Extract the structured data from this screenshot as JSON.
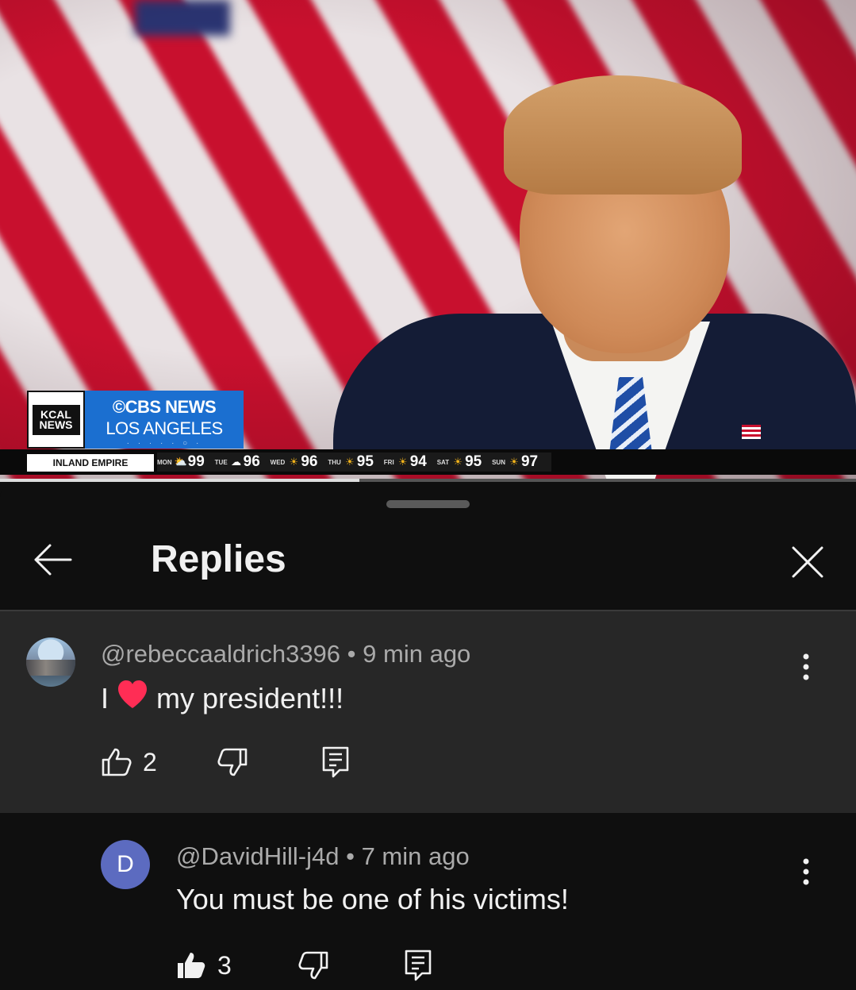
{
  "video": {
    "logo_kcal_line1": "KCAL",
    "logo_kcal_line2": "NEWS",
    "cbs_line1": "©CBS NEWS",
    "cbs_line2": "LOS ANGELES",
    "cbs_dots": "· · · · · ○ ·",
    "region": "INLAND EMPIRE",
    "forecast": [
      {
        "day": "MON",
        "icon": "cloud-sun-icon",
        "temp": "99"
      },
      {
        "day": "TUE",
        "icon": "cloud-icon",
        "temp": "96"
      },
      {
        "day": "WED",
        "icon": "sun-icon",
        "temp": "96"
      },
      {
        "day": "THU",
        "icon": "sun-icon",
        "temp": "95"
      },
      {
        "day": "FRI",
        "icon": "sun-icon",
        "temp": "94"
      },
      {
        "day": "SAT",
        "icon": "sun-icon",
        "temp": "95"
      },
      {
        "day": "SUN",
        "icon": "sun-icon",
        "temp": "97"
      }
    ],
    "progress": 0.42
  },
  "sheet": {
    "title": "Replies"
  },
  "comment": {
    "handle": "@rebeccaaldrich3396",
    "separator": "•",
    "time": "9 min ago",
    "text_before": "I",
    "text_after": "my president!!!",
    "likes": "2"
  },
  "reply": {
    "avatar_letter": "D",
    "handle": "@DavidHill-j4d",
    "separator": "•",
    "time": "7 min ago",
    "text": "You must be one of his victims!",
    "likes": "3"
  },
  "colors": {
    "background": "#0f0f0f",
    "comment_highlight": "#272727",
    "meta_text": "#aaaaaa",
    "reply_avatar": "#5c6bc0",
    "heart": "#ff2d55"
  }
}
